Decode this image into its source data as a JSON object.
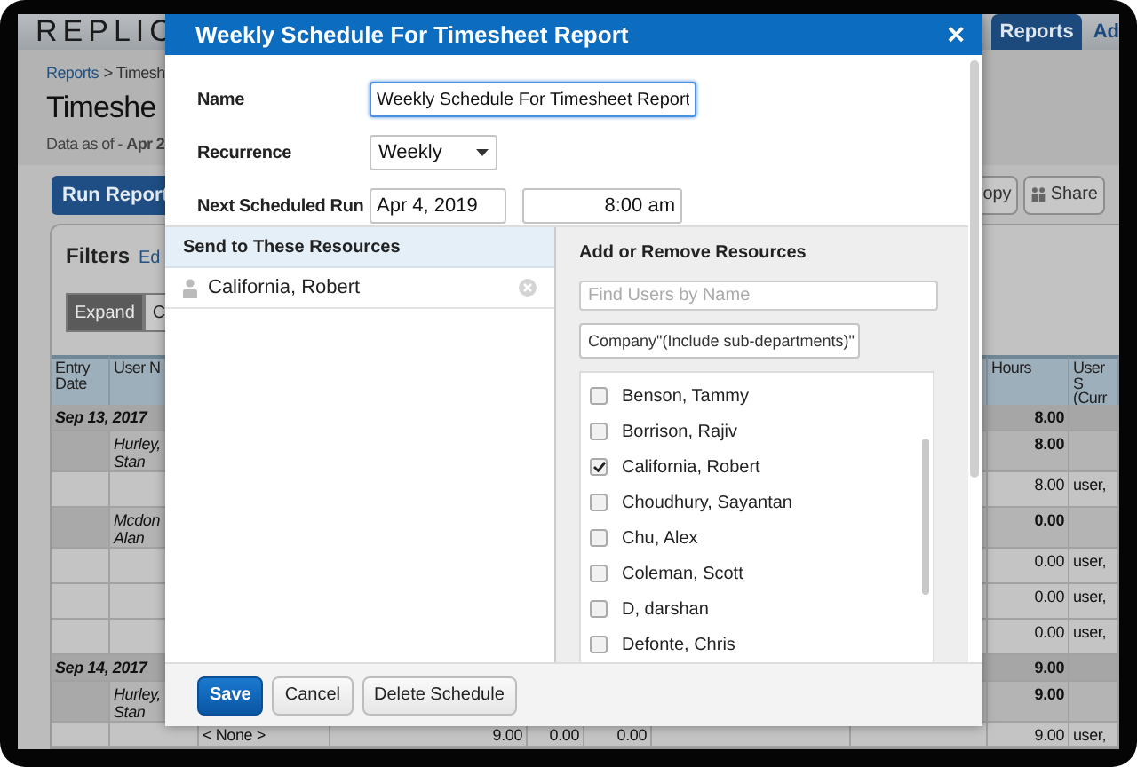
{
  "app": {
    "logo": "REPLIC",
    "nav_tabs": [
      {
        "label": "Reports",
        "selected": true
      },
      {
        "label": "Ad",
        "selected": false
      }
    ],
    "breadcrumb": {
      "link": "Reports",
      "rest": "> Timesh"
    },
    "page_title": "Timeshe",
    "data_as_of": {
      "label": "Data as of -",
      "value": "Apr 2"
    },
    "toolbar": {
      "run_button": "Run Report",
      "copy_button": "opy",
      "share_button": "Share"
    },
    "filters": {
      "title": "Filters",
      "edit_link": "Ed",
      "view_buttons": [
        {
          "label": "Expand",
          "selected": true
        },
        {
          "label": "C",
          "selected": false
        }
      ]
    },
    "table": {
      "columns": [
        "Entry Date",
        "User N",
        "Hours",
        "User S (Curr"
      ],
      "rows": [
        {
          "kind": "group",
          "date": "Sep 13, 2017",
          "hours": "8.00"
        },
        {
          "kind": "person",
          "user_name": "Hurley, Stan",
          "hours": "8.00"
        },
        {
          "kind": "detail",
          "hours": "8.00",
          "user": "user,"
        },
        {
          "kind": "person",
          "user_name": "Mcdon Alan",
          "hours": "0.00"
        },
        {
          "kind": "detail",
          "hours": "0.00",
          "user": "user,"
        },
        {
          "kind": "detail",
          "hours": "0.00",
          "user": "user,"
        },
        {
          "kind": "detail",
          "hours": "0.00",
          "user": "user,"
        },
        {
          "kind": "group",
          "date": "Sep 14, 2017",
          "hours": "9.00"
        },
        {
          "kind": "person",
          "user_name": "Hurley, Stan",
          "hours": "9.00"
        },
        {
          "kind": "detail",
          "project": "< None >",
          "values": [
            "9.00",
            "0.00",
            "0.00"
          ],
          "hours": "9.00",
          "user": "user,"
        }
      ]
    }
  },
  "dialog": {
    "title": "Weekly Schedule For Timesheet Report",
    "close": "×",
    "name": {
      "label": "Name",
      "value": "Weekly Schedule For Timesheet Report"
    },
    "recurrence": {
      "label": "Recurrence",
      "value": "Weekly"
    },
    "next_run": {
      "label": "Next Scheduled Run",
      "date": "Apr 4, 2019",
      "time": "8:00 am"
    },
    "recipients": {
      "title": "Send to These Resources",
      "items": [
        "California, Robert"
      ]
    },
    "resources": {
      "title": "Add or Remove Resources",
      "search": {
        "placeholder": "Find Users by Name"
      },
      "filter": "Company\"(Include sub-departments)\"",
      "users": [
        {
          "name": "Benson, Tammy",
          "checked": false
        },
        {
          "name": "Borrison, Rajiv",
          "checked": false
        },
        {
          "name": "California, Robert",
          "checked": true
        },
        {
          "name": "Choudhury, Sayantan",
          "checked": false
        },
        {
          "name": "Chu, Alex",
          "checked": false
        },
        {
          "name": "Coleman, Scott",
          "checked": false
        },
        {
          "name": "D, darshan",
          "checked": false
        },
        {
          "name": "Defonte, Chris",
          "checked": false
        }
      ]
    },
    "buttons": {
      "save": "Save",
      "cancel": "Cancel",
      "delete": "Delete Schedule"
    }
  }
}
